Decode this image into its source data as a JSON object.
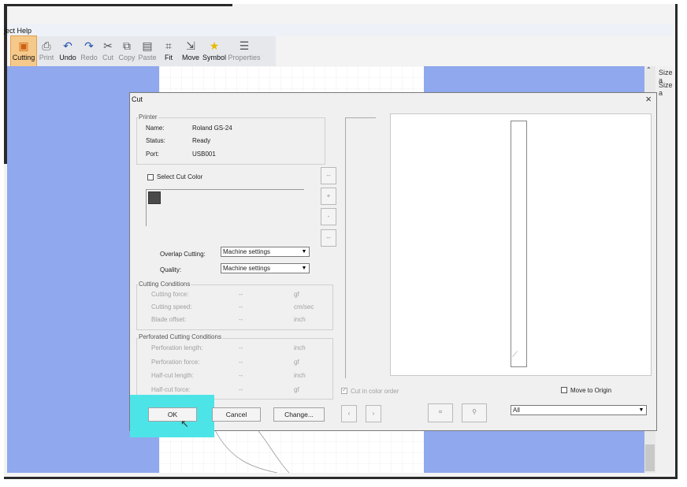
{
  "menu": {
    "text": "ject Help"
  },
  "toolbar": {
    "items": [
      {
        "label": "Cutting",
        "icon": "▣"
      },
      {
        "label": "Print",
        "icon": "⎙"
      },
      {
        "label": "Undo",
        "icon": "↶"
      },
      {
        "label": "Redo",
        "icon": "↷"
      },
      {
        "label": "Cut",
        "icon": "✂"
      },
      {
        "label": "Copy",
        "icon": "⧉"
      },
      {
        "label": "Paste",
        "icon": "▤"
      },
      {
        "label": "Fit",
        "icon": "⌗"
      },
      {
        "label": "Move",
        "icon": "⇲"
      },
      {
        "label": "Symbol",
        "icon": "★"
      },
      {
        "label": "Properties",
        "icon": "☰"
      }
    ]
  },
  "right_panel": {
    "line1": "Size a",
    "line2": "Size a"
  },
  "dialog": {
    "title": "Cut",
    "close": "×",
    "printer": {
      "group_label": "Printer",
      "name_label": "Name:",
      "name_value": "Roland GS-24",
      "status_label": "Status:",
      "status_value": "Ready",
      "port_label": "Port:",
      "port_value": "USB001"
    },
    "select_cut_color": "Select Cut Color",
    "color_swatch": "#4a4a4a",
    "side_buttons": [
      "--",
      "+",
      "-",
      "--"
    ],
    "overlap_label": "Overlap Cutting:",
    "overlap_value": "Machine settings",
    "quality_label": "Quality:",
    "quality_value": "Machine settings",
    "cutting_conditions": {
      "group_label": "Cutting Conditions",
      "rows": [
        {
          "label": "Cutting force:",
          "value": "--",
          "unit": "gf"
        },
        {
          "label": "Cutting speed:",
          "value": "--",
          "unit": "cm/sec"
        },
        {
          "label": "Blade offset:",
          "value": "--",
          "unit": "inch"
        }
      ]
    },
    "perforated": {
      "group_label": "Perforated Cutting Conditions",
      "rows": [
        {
          "label": "Perforation length:",
          "value": "--",
          "unit": "inch"
        },
        {
          "label": "Perforation force:",
          "value": "--",
          "unit": "gf"
        },
        {
          "label": "Half-cut length:",
          "value": "--",
          "unit": "inch"
        },
        {
          "label": "Half-cut force:",
          "value": "--",
          "unit": "gf"
        }
      ]
    },
    "cut_in_color_order": "Cut in color order",
    "move_to_origin": "Move to Origin",
    "page_select_value": "All",
    "buttons": {
      "ok": "OK",
      "cancel": "Cancel",
      "change": "Change..."
    },
    "highlight_color": "#4de4e8"
  }
}
